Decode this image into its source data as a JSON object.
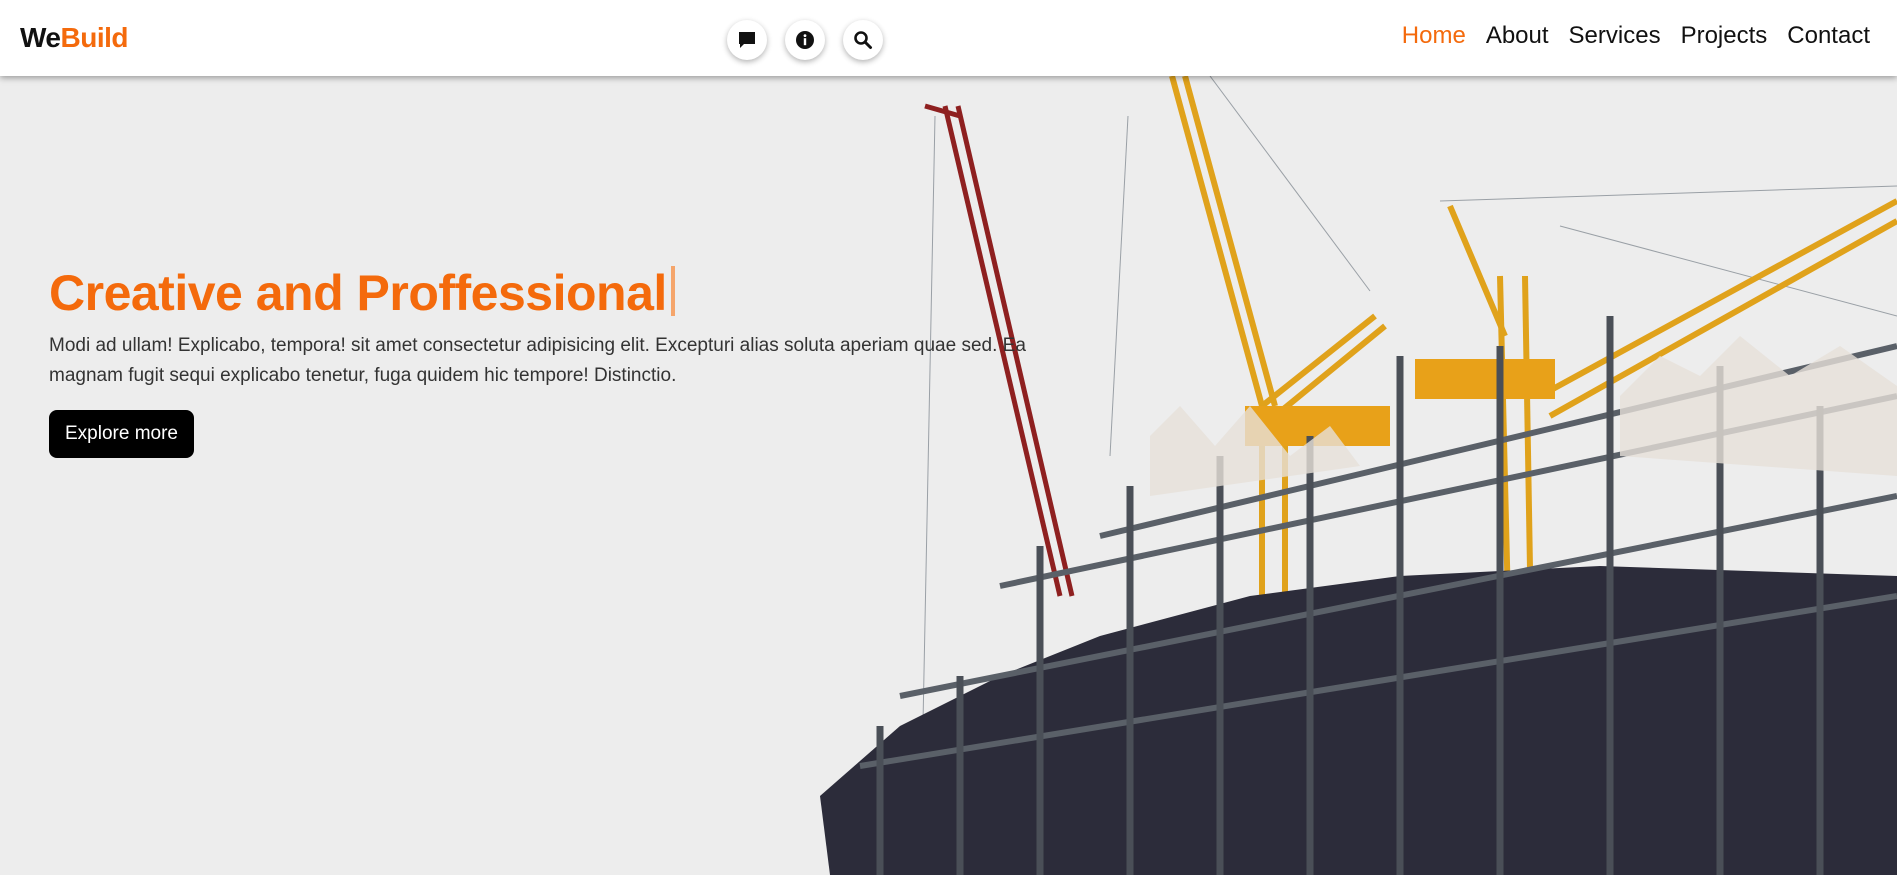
{
  "brand": {
    "prefix": "We",
    "highlight": "Build"
  },
  "toolbar": {
    "icons": [
      "message-icon",
      "info-icon",
      "search-icon"
    ]
  },
  "nav": {
    "items": [
      {
        "label": "Home"
      },
      {
        "label": "About"
      },
      {
        "label": "Services"
      },
      {
        "label": "Projects"
      },
      {
        "label": "Contact"
      }
    ],
    "active": "Home"
  },
  "hero": {
    "title": "Creative and Proffessional",
    "text": "Modi ad ullam! Explicabo, tempora! sit amet consectetur adipisicing elit. Excepturi alias soluta aperiam quae sed. Ea magnam fugit sequi explicabo tenetur, fuga quidem hic tempore! Distinctio.",
    "cta": "Explore more"
  },
  "colors": {
    "accent": "#f46a0c",
    "button": "#000000",
    "background": "#ededed"
  }
}
